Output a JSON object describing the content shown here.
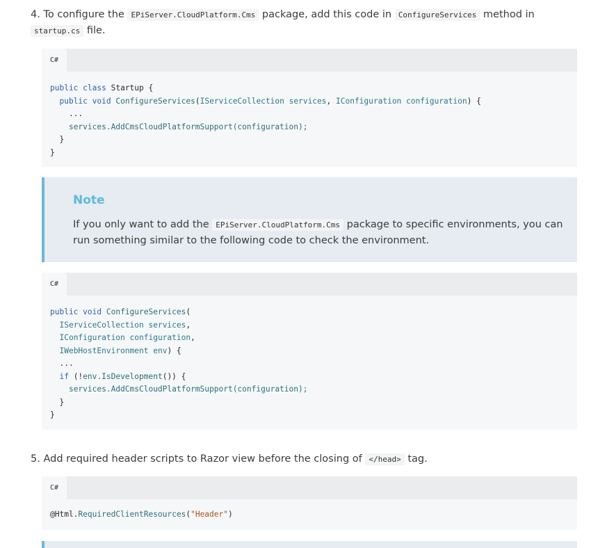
{
  "step4": {
    "number": "4.",
    "t1": "To configure the",
    "code1": "EPiServer.CloudPlatform.Cms",
    "t2": "package, add this code in",
    "code2": "ConfigureServices",
    "t3": "method in",
    "code3": "startup.cs",
    "t4": "file."
  },
  "code_block_1": {
    "lang": "C#",
    "lines": [
      "public class Startup {",
      "  public void ConfigureServices(IServiceCollection services, IConfiguration configuration) {",
      "    ...",
      "    services.AddCmsCloudPlatformSupport(configuration);",
      "  }",
      "}"
    ]
  },
  "note": {
    "title": "Note",
    "t1": "If you only want to add the",
    "code": "EPiServer.CloudPlatform.Cms",
    "t2": "package to specific environments, you can run something similar to the following code to check the environment."
  },
  "code_block_2": {
    "lang": "C#",
    "lines": [
      "public void ConfigureServices(",
      "  IServiceCollection services,",
      "  IConfiguration configuration,",
      "  IWebHostEnvironment env) {",
      "  ...",
      "  if (!env.IsDevelopment()) {",
      "    services.AddCmsCloudPlatformSupport(configuration);",
      "  }",
      "}"
    ]
  },
  "step5": {
    "number": "5.",
    "t1": "Add required header scripts to Razor view before the closing of",
    "code1": "</head>",
    "t2": "tag."
  },
  "code_block_3": {
    "lang": "C#",
    "lines": [
      "@Html.RequiredClientResources(\"Header\")"
    ]
  }
}
